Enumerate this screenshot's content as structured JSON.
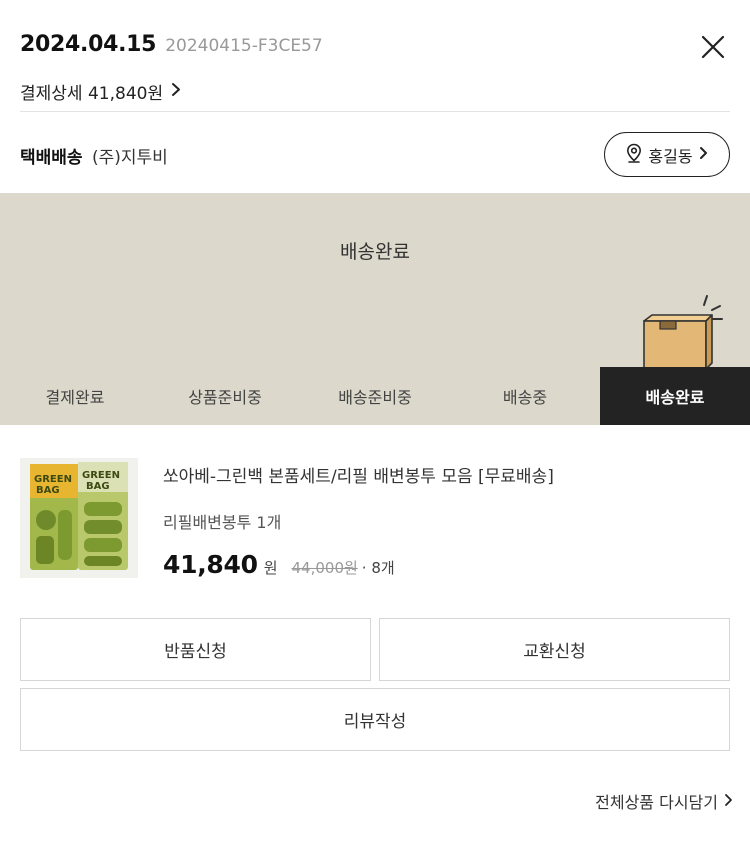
{
  "order": {
    "date": "2024.04.15",
    "number": "20240415-F3CE57",
    "payment_detail_label": "결제상세 41,840원"
  },
  "delivery": {
    "type": "택배배송",
    "courier": "(주)지투비",
    "recipient": "홍길동"
  },
  "status": {
    "title": "배송완료",
    "steps": [
      "결제완료",
      "상품준비중",
      "배송준비중",
      "배송중",
      "배송완료"
    ],
    "active_index": 4
  },
  "product": {
    "name": "쏘아베-그린백 본품세트/리필 배변봉투 모음 [무료배송]",
    "option": "리필배변봉투 1개",
    "price": "41,840",
    "price_unit": "원",
    "original_price": "44,000원",
    "quantity": "· 8개",
    "thumb_brand_text": "GREEN BAG"
  },
  "actions": {
    "return_label": "반품신청",
    "exchange_label": "교환신청",
    "review_label": "리뷰작성",
    "recart_label": "전체상품 다시담기"
  },
  "colors": {
    "banner_bg": "#dcd8cb",
    "active_step_bg": "#232323",
    "box_color": "#e3b877"
  },
  "icons": {
    "close": "close-icon",
    "chevron": "chevron-right-icon",
    "pin": "location-pin-icon",
    "box": "delivery-box-icon"
  }
}
